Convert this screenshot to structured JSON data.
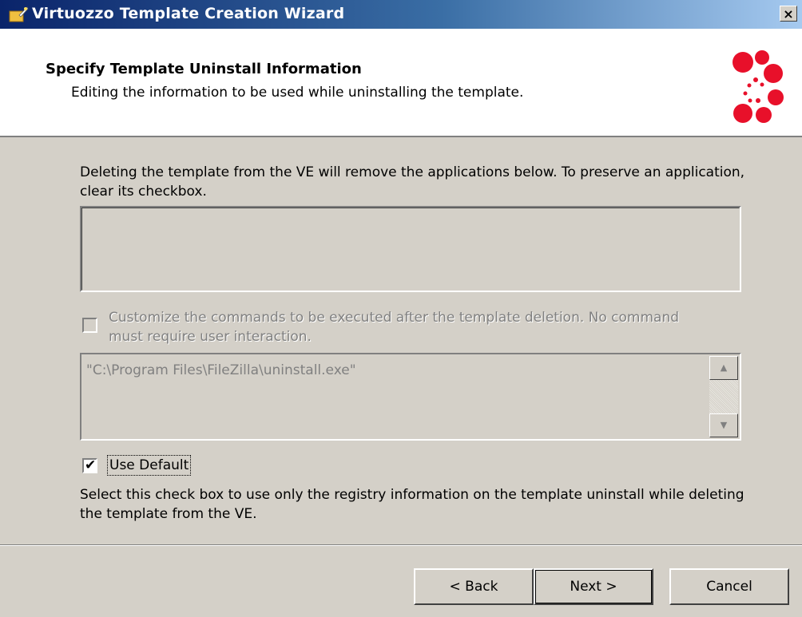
{
  "window": {
    "title": "Virtuozzo Template Creation Wizard",
    "icon": "wizard-icon",
    "close_label": "×",
    "close_icon": "close-icon"
  },
  "header": {
    "title": "Specify Template Uninstall Information",
    "subtitle": "Editing the information to be used while uninstalling the template.",
    "logo": "virtuozzo-logo",
    "logo_color": "#e8102a"
  },
  "content": {
    "description": "Deleting the template from the VE will remove the applications below. To preserve an application, clear its checkbox.",
    "applications": [],
    "customize": {
      "checked": false,
      "enabled": false,
      "label": "Customize the commands to be executed after the template deletion. No command must require user interaction."
    },
    "command_text": "\"C:\\Program Files\\FileZilla\\uninstall.exe\"",
    "use_default": {
      "checked": true,
      "label": "Use Default"
    },
    "hint": "Select this check box to use only the registry information on the template uninstall while deleting the template from the VE."
  },
  "buttons": {
    "back": "< Back",
    "next": "Next >",
    "cancel": "Cancel"
  }
}
